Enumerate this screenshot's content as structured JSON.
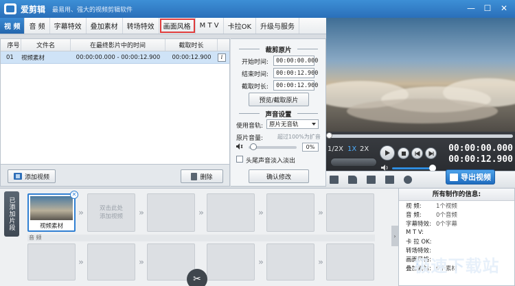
{
  "window": {
    "app_title": "爱剪辑",
    "slogan": "最易用、强大的视频剪辑软件",
    "controls": [
      "—",
      "☐",
      "✕"
    ]
  },
  "tabs": [
    {
      "label": "视 频",
      "active": true
    },
    {
      "label": "音 频"
    },
    {
      "label": "字幕特效"
    },
    {
      "label": "叠加素材"
    },
    {
      "label": "转场特效"
    },
    {
      "label": "画面风格",
      "highlight": true
    },
    {
      "label": "M T V"
    },
    {
      "label": "卡拉OK"
    },
    {
      "label": "升级与服务"
    }
  ],
  "filelist": {
    "headers": [
      "序号",
      "文件名",
      "在最终影片中的时间",
      "截取时长"
    ],
    "rows": [
      {
        "index": "01",
        "name": "视频素材",
        "range": "00:00:00.000 - 00:00:12.900",
        "duration": "00:00:12.900"
      }
    ],
    "info_icon": "i"
  },
  "buttons": {
    "add_video": "添加视频",
    "delete": "删除",
    "preview_cut": "预览/截取原片",
    "confirm": "确认修改",
    "export": "导出视频"
  },
  "cut": {
    "section_title": "裁剪原片",
    "start_label": "开始时间:",
    "start_value": "00:00:00.000",
    "end_label": "结束时间:",
    "end_value": "00:00:12.900",
    "duration_label": "截取时长:",
    "duration_value": "00:00:12.900"
  },
  "audio": {
    "section_title": "声音设置",
    "track_label": "使用音轨:",
    "track_value": "原片无音轨",
    "volume_label": "原片音量:",
    "volume_hint": "超过100%为扩音",
    "volume_value": "0%",
    "volume_level": 0.0,
    "fade_label": "头尾声音淡入淡出"
  },
  "player": {
    "speeds": [
      "1/2X",
      "1X",
      "2X"
    ],
    "current_time": "00:00:00.000",
    "total_time": "00:00:12.900",
    "playback_progress": 0.0
  },
  "timeline": {
    "side_label": "已添加片段",
    "clip_caption": "视频素材",
    "remove_glyph": "✕",
    "empty_hint": "双击此处\n添加视频",
    "audio_label": "音 频",
    "scissor_glyph": "✂",
    "collapse_glyph": "›"
  },
  "info": {
    "title": "所有制作的信息:",
    "rows": [
      {
        "k": "视  频:",
        "v": "1个视频"
      },
      {
        "k": "音  频:",
        "v": "0个音频"
      },
      {
        "k": "字幕特效:",
        "v": "0个字幕"
      },
      {
        "k": "M T V:",
        "v": ""
      },
      {
        "k": "卡 拉 OK:",
        "v": ""
      },
      {
        "k": "转场特效:",
        "v": ""
      },
      {
        "k": "画面风格:",
        "v": ""
      },
      {
        "k": "叠加素材:",
        "v": "0个素材"
      }
    ]
  },
  "watermark": "极速下载站",
  "colors": {
    "accent": "#2f7fd2",
    "highlight": "#e03b3b"
  }
}
